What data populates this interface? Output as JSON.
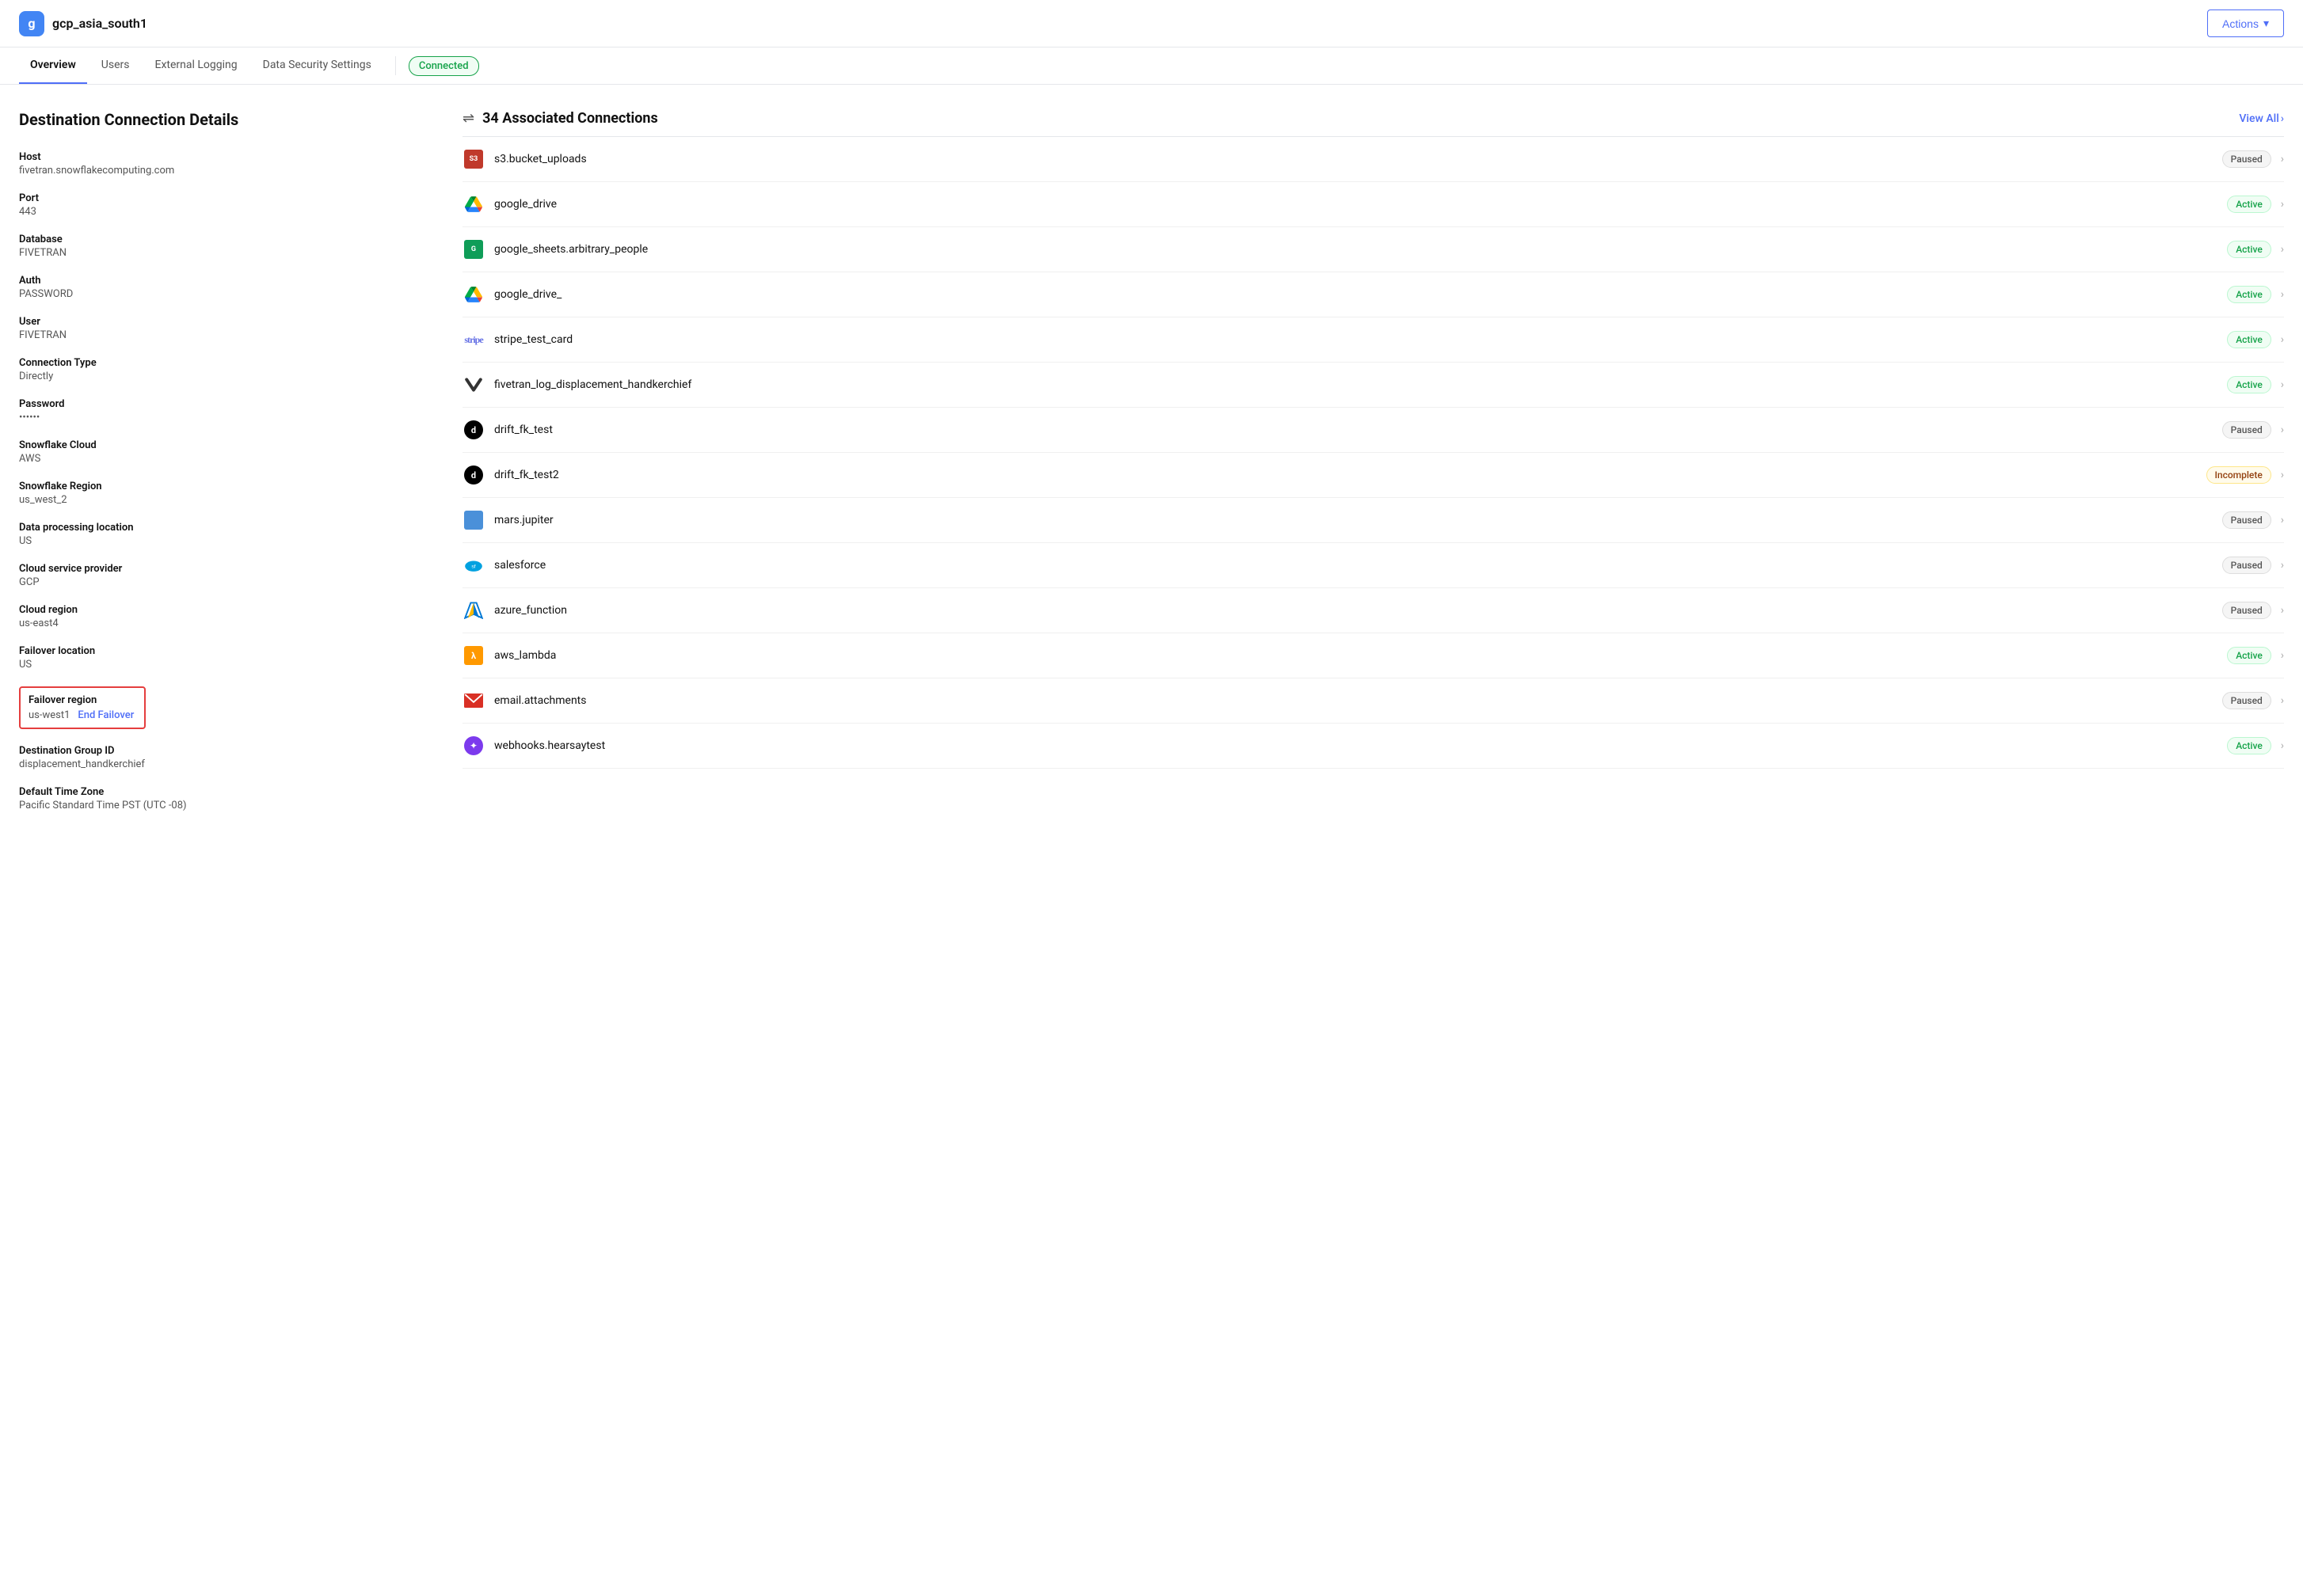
{
  "header": {
    "logo_text": "g",
    "app_title": "gcp_asia_south1",
    "actions_label": "Actions"
  },
  "nav": {
    "items": [
      {
        "id": "overview",
        "label": "Overview",
        "active": true
      },
      {
        "id": "users",
        "label": "Users",
        "active": false
      },
      {
        "id": "external-logging",
        "label": "External Logging",
        "active": false
      },
      {
        "id": "data-security",
        "label": "Data Security Settings",
        "active": false
      }
    ],
    "status": "Connected"
  },
  "left": {
    "section_title": "Destination Connection Details",
    "fields": [
      {
        "label": "Host",
        "value": "fivetran.snowflakecomputing.com"
      },
      {
        "label": "Port",
        "value": "443"
      },
      {
        "label": "Database",
        "value": "FIVETRAN"
      },
      {
        "label": "Auth",
        "value": "PASSWORD"
      },
      {
        "label": "User",
        "value": "FIVETRAN"
      },
      {
        "label": "Connection Type",
        "value": "Directly"
      },
      {
        "label": "Password",
        "value": "••••••"
      },
      {
        "label": "Snowflake Cloud",
        "value": "AWS"
      },
      {
        "label": "Snowflake Region",
        "value": "us_west_2"
      },
      {
        "label": "Data processing location",
        "value": "US"
      },
      {
        "label": "Cloud service provider",
        "value": "GCP"
      },
      {
        "label": "Cloud region",
        "value": "us-east4"
      },
      {
        "label": "Failover location",
        "value": "US"
      }
    ],
    "failover_region": {
      "label": "Failover region",
      "value": "us-west1",
      "link_label": "End Failover"
    },
    "extra_fields": [
      {
        "label": "Destination Group ID",
        "value": "displacement_handkerchief"
      },
      {
        "label": "Default Time Zone",
        "value": "Pacific Standard Time PST (UTC -08)"
      }
    ]
  },
  "right": {
    "assoc_count": "34",
    "assoc_title": "Associated Connections",
    "view_all_label": "View All",
    "connections": [
      {
        "id": "s3-bucket-uploads",
        "name": "s3.bucket_uploads",
        "status": "Paused",
        "icon_type": "s3"
      },
      {
        "id": "google-drive-1",
        "name": "google_drive",
        "status": "Active",
        "icon_type": "gdrive"
      },
      {
        "id": "google-sheets",
        "name": "google_sheets.arbitrary_people",
        "status": "Active",
        "icon_type": "gsheets"
      },
      {
        "id": "google-drive-2",
        "name": "google_drive_",
        "status": "Active",
        "icon_type": "gdrive"
      },
      {
        "id": "stripe-test-card",
        "name": "stripe_test_card",
        "status": "Active",
        "icon_type": "stripe"
      },
      {
        "id": "fivetran-log",
        "name": "fivetran_log_displacement_handkerchief",
        "status": "Active",
        "icon_type": "fivetran"
      },
      {
        "id": "drift-fk-test",
        "name": "drift_fk_test",
        "status": "Paused",
        "icon_type": "drift"
      },
      {
        "id": "drift-fk-test2",
        "name": "drift_fk_test2",
        "status": "Incomplete",
        "icon_type": "drift"
      },
      {
        "id": "mars-jupiter",
        "name": "mars.jupiter",
        "status": "Paused",
        "icon_type": "mars"
      },
      {
        "id": "salesforce",
        "name": "salesforce",
        "status": "Paused",
        "icon_type": "salesforce"
      },
      {
        "id": "azure-function",
        "name": "azure_function",
        "status": "Paused",
        "icon_type": "azure"
      },
      {
        "id": "aws-lambda",
        "name": "aws_lambda",
        "status": "Active",
        "icon_type": "lambda"
      },
      {
        "id": "email-attachments",
        "name": "email.attachments",
        "status": "Paused",
        "icon_type": "email"
      },
      {
        "id": "webhooks-hearsay",
        "name": "webhooks.hearsaytest",
        "status": "Active",
        "icon_type": "webhook"
      }
    ]
  }
}
